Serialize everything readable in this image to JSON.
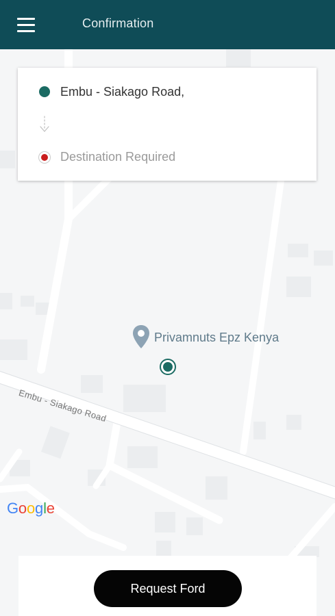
{
  "app_bar": {
    "title": "Confirmation",
    "menu_icon": "hamburger-menu-icon",
    "color": "#0f4c57"
  },
  "route": {
    "origin": "Embu - Siakago Road,",
    "origin_icon": "origin-dot-icon",
    "origin_color": "#1b6b63",
    "connector_icon": "dotted-arrow-down-icon",
    "destination_placeholder": "Destination Required",
    "destination_icon": "destination-dot-icon",
    "destination_color": "#c91c1c"
  },
  "map": {
    "place_name": "Privamnuts Epz Kenya",
    "place_icon": "map-pin-icon",
    "road_name": "Embu - Siakago Road",
    "current_location_icon": "current-location-icon",
    "attribution": {
      "letters": [
        {
          "ch": "G",
          "color": "#4285F4"
        },
        {
          "ch": "o",
          "color": "#EA4335"
        },
        {
          "ch": "o",
          "color": "#FBBC05"
        },
        {
          "ch": "g",
          "color": "#4285F4"
        },
        {
          "ch": "l",
          "color": "#34A853"
        },
        {
          "ch": "e",
          "color": "#EA4335"
        }
      ]
    }
  },
  "actions": {
    "request_label": "Request Ford"
  }
}
